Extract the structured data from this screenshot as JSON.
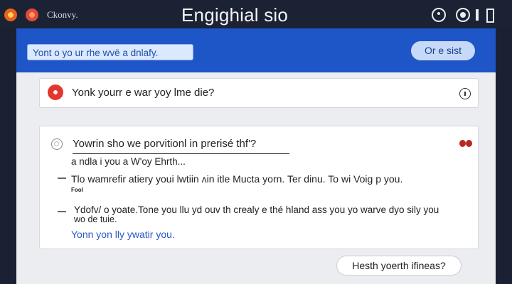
{
  "titlebar": {
    "app_name": "Ckonvy.",
    "window_title": "Engighial sio"
  },
  "header": {
    "search_text": "Yont o yo ur rhe wvë a dnlafy.",
    "button_label": "Or e sist"
  },
  "main": {
    "card1": {
      "text": "Yonk yourr e war yoy lme die?"
    },
    "card2": {
      "question": "Yowrin sho we porvitionl in prerisé thf'?",
      "answer_1": "a ndla i you a W'oy Ehrth...",
      "line_a": "Tlo wamrefir atiery youi lwtiin ʌin itle Mucta yorn. Ter dinu. To wi Voig p you.",
      "line_a_small": "Fool",
      "line_b": "Ydofv/ o yoate.Tone you llu yd ouv th crealy e thé hland ass you yo warve dyo sily you",
      "line_b_sub": "wo de tuie.",
      "link": "Yonn yon lly ywatir you."
    },
    "reply_button": "Hesth yoerth ifineas?"
  },
  "colors": {
    "header_blue": "#1e56c7",
    "link_blue": "#2b58c7",
    "record_red": "#e3372e"
  }
}
